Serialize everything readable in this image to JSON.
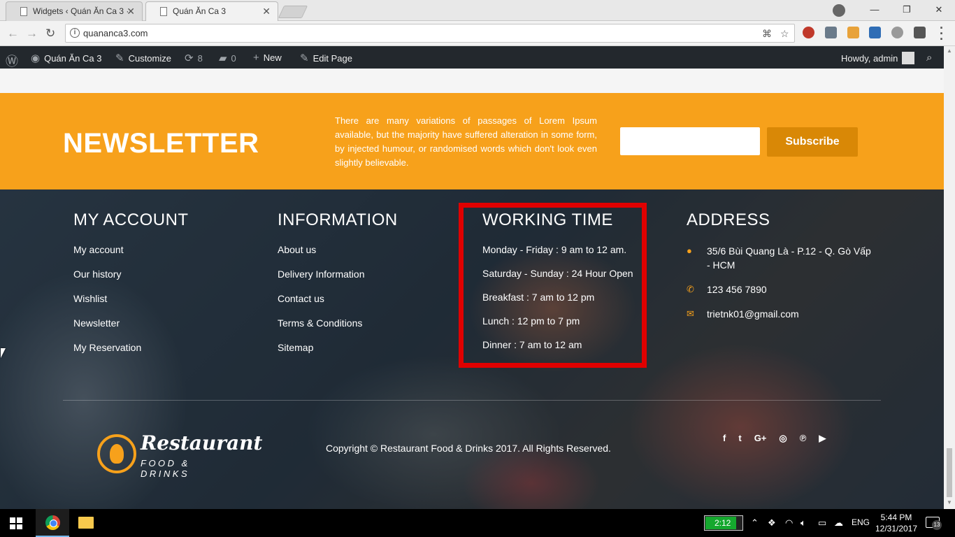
{
  "browser": {
    "tabs": [
      {
        "title": "Widgets ‹ Quán Ăn Ca 3 ·",
        "active": false
      },
      {
        "title": "Quán Ăn Ca 3",
        "active": true
      }
    ],
    "url": "quananca3.com",
    "window_controls": {
      "minimize": "—",
      "maximize": "❐",
      "close": "✕"
    }
  },
  "admin_bar": {
    "site_name": "Quán Ăn Ca 3",
    "customize": "Customize",
    "updates_count": "8",
    "comments_count": "0",
    "new_label": "New",
    "edit_label": "Edit Page",
    "howdy": "Howdy, admin"
  },
  "newsletter": {
    "title": "NEWSLETTER",
    "text": "There are many variations of passages of Lorem Ipsum available, but the majority have suffered alteration in some form, by injected humour, or randomised words which don't look even slightly believable.",
    "input_value": "",
    "button": "Subscribe",
    "colors": {
      "background": "#f7a11b",
      "button": "#d98806"
    }
  },
  "footer": {
    "account": {
      "title": "MY ACCOUNT",
      "links": [
        "My account",
        "Our history",
        "Wishlist",
        "Newsletter",
        "My Reservation"
      ]
    },
    "information": {
      "title": "INFORMATION",
      "links": [
        "About us",
        "Delivery Information",
        "Contact us",
        "Terms & Conditions",
        "Sitemap"
      ]
    },
    "working_time": {
      "title": "WORKING TIME",
      "items": [
        "Monday - Friday : 9 am to 12 am.",
        "Saturday - Sunday : 24 Hour Open",
        "Breakfast : 7 am to 12 pm",
        "Lunch : 12 pm to 7 pm",
        "Dinner : 7 am to 12 am"
      ],
      "highlight_color": "#e00000"
    },
    "address": {
      "title": "ADDRESS",
      "street": "35/6 Bùi Quang Là - P.12 - Q. Gò Vấp - HCM",
      "phone": "123 456 7890",
      "email": "trietnk01@gmail.com"
    },
    "logo": {
      "name": "Restaurant",
      "tagline": "FOOD & DRINKS"
    },
    "copyright": "Copyright © Restaurant Food & Drinks 2017. All Rights Reserved.",
    "social": [
      "f",
      "t",
      "G+",
      "◎",
      "℗",
      "▶"
    ]
  },
  "taskbar": {
    "battery_time": "2:12",
    "battery_level": 0.85,
    "language": "ENG",
    "time": "5:44 PM",
    "date": "12/31/2017",
    "notifications": "13"
  }
}
